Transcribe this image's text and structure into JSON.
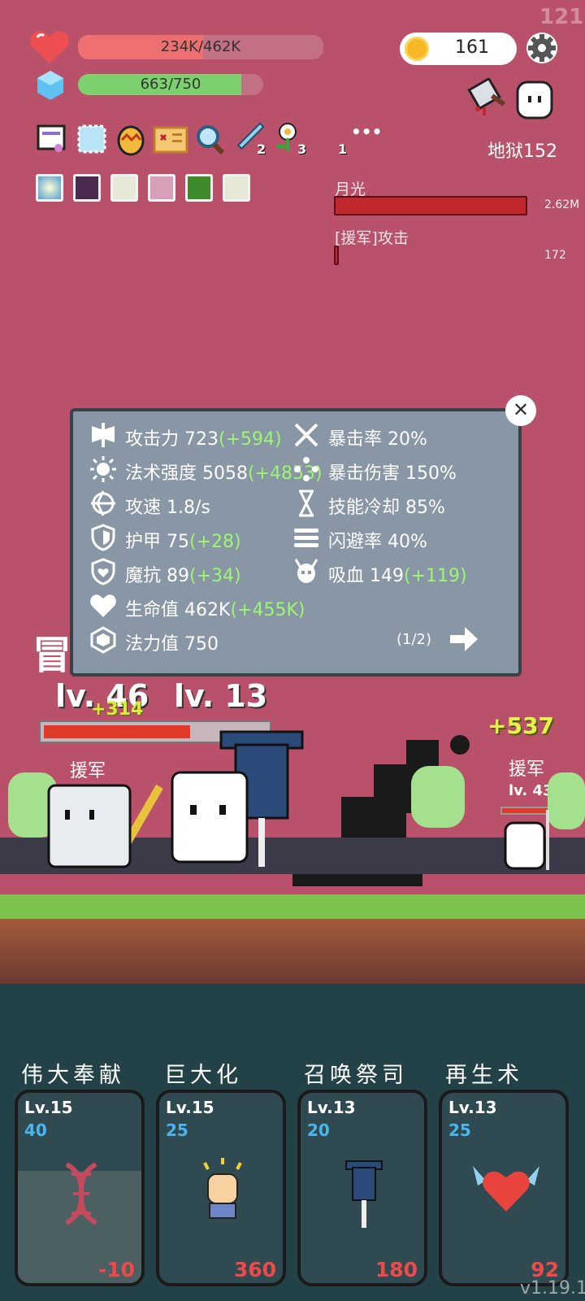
{
  "fps": "121",
  "hp": {
    "text": "234K/462K",
    "fraction": 0.51,
    "color": "#ee6f6f"
  },
  "mana": {
    "text": "663/750",
    "fraction": 0.88,
    "color": "#7cd06d"
  },
  "coins": "161",
  "stage": "地狱152",
  "inventory": {
    "badge_sword": "2",
    "badge_flower": "3",
    "badge_more": "1",
    "more_label": "•••"
  },
  "damage": {
    "moonlight": {
      "label": "月光",
      "value": "2.62M",
      "fraction": 1.0
    },
    "ally": {
      "label": "[援军]攻击",
      "value": "172",
      "fraction": 0.02
    }
  },
  "stats_panel": {
    "left": [
      {
        "label": "攻击力",
        "value": "723",
        "bonus": "(+594)",
        "icon": "axe-icon"
      },
      {
        "label": "法术强度",
        "value": "5058",
        "bonus": "(+4853)",
        "icon": "sun-icon"
      },
      {
        "label": "攻速",
        "value": "1.8/s",
        "bonus": "",
        "icon": "attack-speed-icon"
      },
      {
        "label": "护甲",
        "value": "75",
        "bonus": "(+28)",
        "icon": "shield-icon"
      },
      {
        "label": "魔抗",
        "value": "89",
        "bonus": "(+34)",
        "icon": "magic-shield-icon"
      },
      {
        "label": "生命值",
        "value": "462K",
        "bonus": "(+455K)",
        "icon": "heart-icon"
      },
      {
        "label": "法力值",
        "value": "750",
        "bonus": "",
        "icon": "mana-gem-icon"
      }
    ],
    "right": [
      {
        "label": "暴击率",
        "value": "20%",
        "icon": "crit-icon"
      },
      {
        "label": "暴击伤害",
        "value": "150%",
        "icon": "crit-damage-icon"
      },
      {
        "label": "技能冷却",
        "value": "85%",
        "icon": "hourglass-icon"
      },
      {
        "label": "闪避率",
        "value": "40%",
        "icon": "dodge-icon"
      },
      {
        "label": "吸血",
        "value": "149",
        "bonus": "(+119)",
        "icon": "lifesteal-icon"
      }
    ],
    "page": "(1/2)",
    "close_label": "✕"
  },
  "battle": {
    "partial_title": "冒",
    "player_lv": "lv. 46",
    "ally_lv": "lv. 13",
    "ally_tag": "援军",
    "right_ally_tag": "援军",
    "right_ally_lv": "lv. 43",
    "float_num": "+537",
    "float_small": "+314"
  },
  "skills": [
    {
      "name": "伟大奉献",
      "lv": "Lv.15",
      "cost": "40",
      "value": "-10",
      "icon": "dna-icon"
    },
    {
      "name": "巨大化",
      "lv": "Lv.15",
      "cost": "25",
      "value": "360",
      "icon": "fist-icon"
    },
    {
      "name": "召唤祭司",
      "lv": "Lv.13",
      "cost": "20",
      "value": "180",
      "icon": "banner-icon"
    },
    {
      "name": "再生术",
      "lv": "Lv.13",
      "cost": "25",
      "value": "92",
      "icon": "winged-heart-icon"
    }
  ],
  "version": "v1.19.1"
}
